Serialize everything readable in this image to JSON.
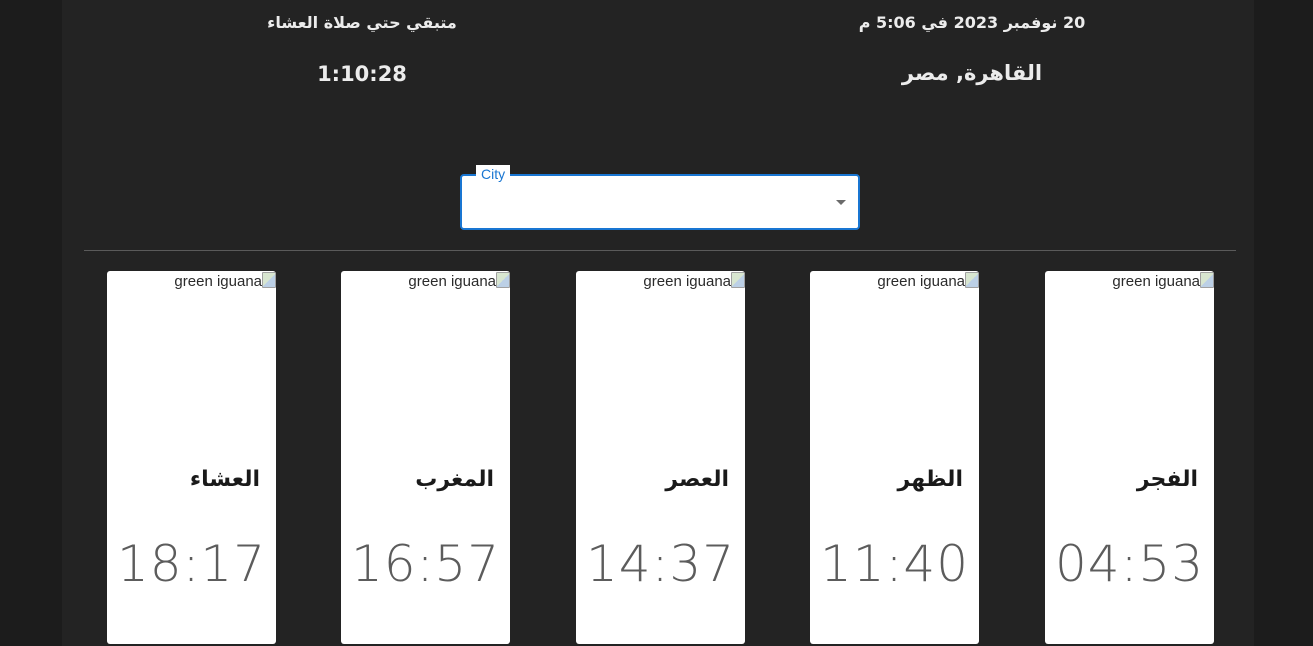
{
  "header": {
    "date": "20 نوفمبر 2023 في 5:06 م",
    "location": "القاهرة, مصر",
    "countdown_label": "متبقي حتي صلاة العشاء",
    "countdown_value": "1:10:28"
  },
  "city_select": {
    "label": "City",
    "value": ""
  },
  "prayer_cards": [
    {
      "name": "العشاء",
      "time": "18:17",
      "image_alt": "green iguana",
      "icon": "broken-image-icon"
    },
    {
      "name": "المغرب",
      "time": "16:57",
      "image_alt": "green iguana",
      "icon": "broken-image-icon"
    },
    {
      "name": "العصر",
      "time": "14:37",
      "image_alt": "green iguana",
      "icon": "broken-image-icon"
    },
    {
      "name": "الظهر",
      "time": "11:40",
      "image_alt": "green iguana",
      "icon": "broken-image-icon"
    },
    {
      "name": "الفجر",
      "time": "04:53",
      "image_alt": "green iguana",
      "icon": "broken-image-icon"
    }
  ],
  "colors": {
    "background": "#232323",
    "accent": "#1976d2",
    "card": "#ffffff",
    "time_text": "#5c5c5c"
  }
}
